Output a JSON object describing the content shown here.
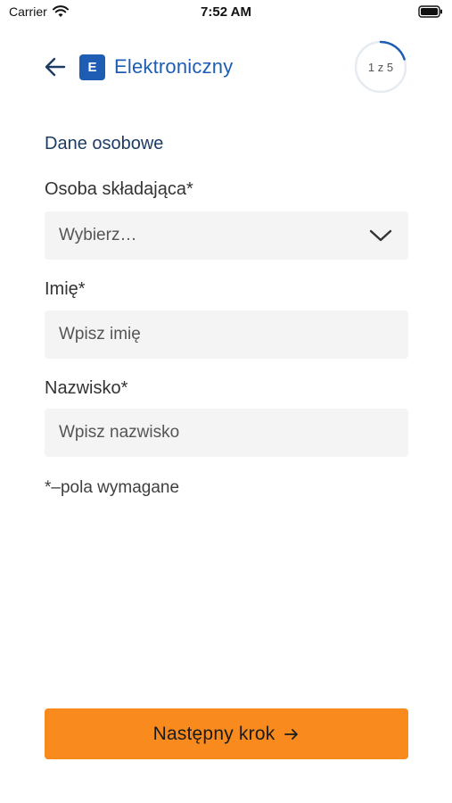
{
  "status_bar": {
    "carrier": "Carrier",
    "time": "7:52 AM",
    "icons": [
      "wifi-icon",
      "battery-icon"
    ]
  },
  "header": {
    "badge_letter": "E",
    "title": "Elektroniczny",
    "step": "1 z 5",
    "step_progress": 0.2,
    "icons": [
      "back-arrow-icon"
    ]
  },
  "form": {
    "section_title": "Dane osobowe",
    "fields": [
      {
        "label": "Osoba składająca*",
        "placeholder": "Wybierz…",
        "type": "select"
      },
      {
        "label": "Imię*",
        "placeholder": "Wpisz imię",
        "type": "text"
      },
      {
        "label": "Nazwisko*",
        "placeholder": "Wpisz nazwisko",
        "type": "text"
      }
    ],
    "required_note": "*–pola wymagane"
  },
  "footer": {
    "next_label": "Następny krok",
    "icon": "arrow-right-icon"
  },
  "colors": {
    "brand_blue": "#1f5db5",
    "section_title": "#1e3b63",
    "cta_orange": "#f88a1e",
    "field_bg": "#f4f4f4"
  }
}
